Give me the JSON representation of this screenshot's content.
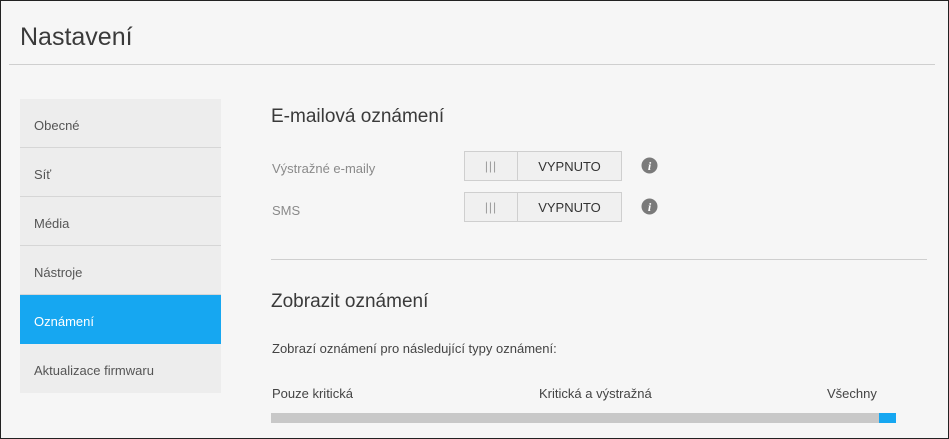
{
  "page": {
    "title": "Nastavení"
  },
  "sidebar": {
    "items": [
      {
        "label": "Obecné",
        "active": false
      },
      {
        "label": "Síť",
        "active": false
      },
      {
        "label": "Média",
        "active": false
      },
      {
        "label": "Nástroje",
        "active": false
      },
      {
        "label": "Oznámení",
        "active": true
      },
      {
        "label": "Aktualizace firmwaru",
        "active": false
      }
    ]
  },
  "email_section": {
    "title": "E-mailová oznámení",
    "rows": [
      {
        "label": "Výstražné e-maily",
        "toggle_state": "VYPNUTO",
        "grip": "|||",
        "icon": "info-icon"
      },
      {
        "label": "SMS",
        "toggle_state": "VYPNUTO",
        "grip": "|||",
        "icon": "info-icon"
      }
    ]
  },
  "display_section": {
    "title": "Zobrazit oznámení",
    "description": "Zobrazí oznámení pro následující typy oznámení:",
    "levels": [
      "Pouze kritická",
      "Kritická a výstražná",
      "Všechny"
    ],
    "selected_level": "Všechny",
    "slider_value_fraction": 1.0
  },
  "colors": {
    "accent": "#16a7f1",
    "sidebar_bg": "#ededed",
    "track": "#c8c8c8"
  }
}
